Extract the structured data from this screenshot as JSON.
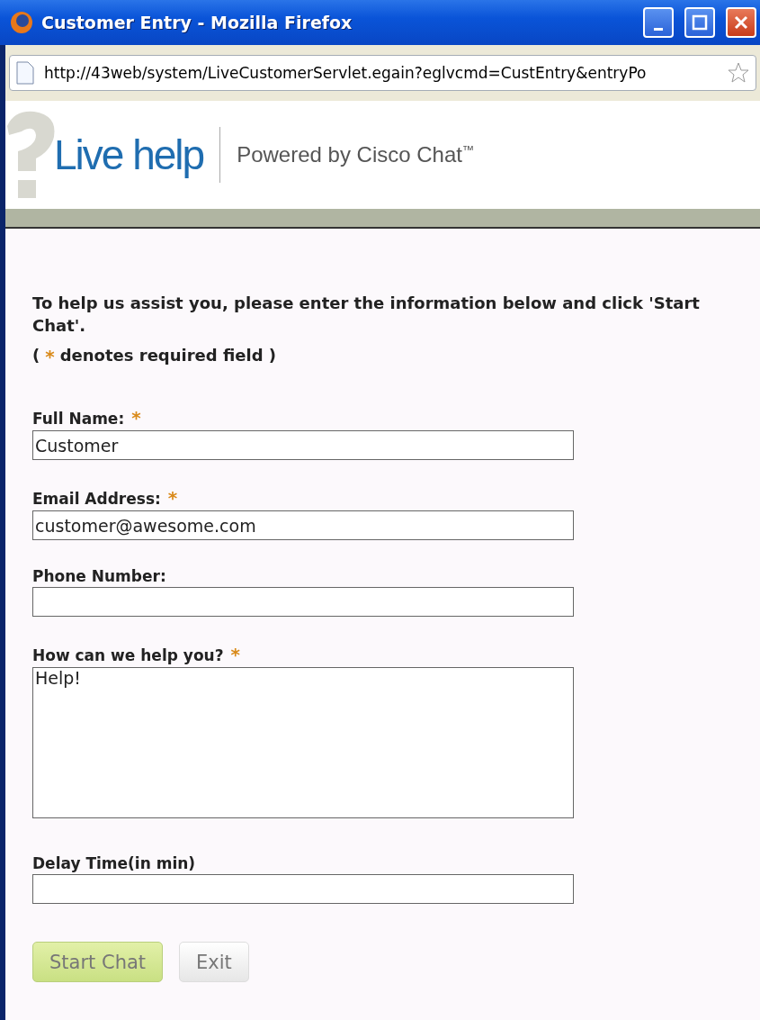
{
  "window": {
    "title": "Customer Entry - Mozilla Firefox"
  },
  "address_bar": {
    "url": "http://43web/system/LiveCustomerServlet.egain?eglvcmd=CustEntry&entryPo"
  },
  "header": {
    "logo": "Live help",
    "tagline": "Powered by Cisco Chat",
    "trademark": "™"
  },
  "intro": "To help us assist you, please enter the information below and click 'Start Chat'.",
  "note": {
    "open": "(",
    "marker": "*",
    "text": "denotes required field )"
  },
  "fields": [
    {
      "label": "Full Name:",
      "marker": "*",
      "kind": "text",
      "value": "Customer"
    },
    {
      "label": "Email Address:",
      "marker": "*",
      "kind": "text",
      "value": "customer@awesome.com"
    },
    {
      "label": "Phone Number:",
      "kind": "text"
    },
    {
      "label": "How can we help you?",
      "marker": "*",
      "kind": "textarea",
      "value": "Help!"
    },
    {
      "label": "Delay Time(in min)",
      "kind": "text"
    }
  ],
  "buttons": [
    {
      "label": "Start Chat",
      "kind": "primary"
    },
    {
      "label": "Exit",
      "kind": "secondary"
    }
  ]
}
